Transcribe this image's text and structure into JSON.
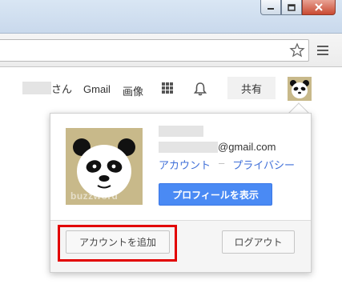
{
  "window": {
    "buttons": {
      "minimize": "minimize-icon",
      "maximize": "maximize-icon",
      "close": "close-icon"
    }
  },
  "toolbar": {
    "star_icon": "star-icon",
    "menu_icon": "menu-icon"
  },
  "googlebar": {
    "user_suffix": "さん",
    "gmail": "Gmail",
    "images": "画像",
    "apps_icon": "apps-grid-icon",
    "notifications_icon": "bell-icon",
    "share": "共有"
  },
  "popup": {
    "email_domain": "@gmail.com",
    "account_link": "アカウント",
    "separator": "–",
    "privacy_link": "プライバシー",
    "profile_button": "プロフィールを表示",
    "watermark": "buzzword",
    "add_account_button": "アカウントを追加",
    "logout_button": "ログアウト"
  },
  "colors": {
    "accent": "#4a8af4",
    "link": "#3f6fd8",
    "highlight": "#e20000"
  }
}
